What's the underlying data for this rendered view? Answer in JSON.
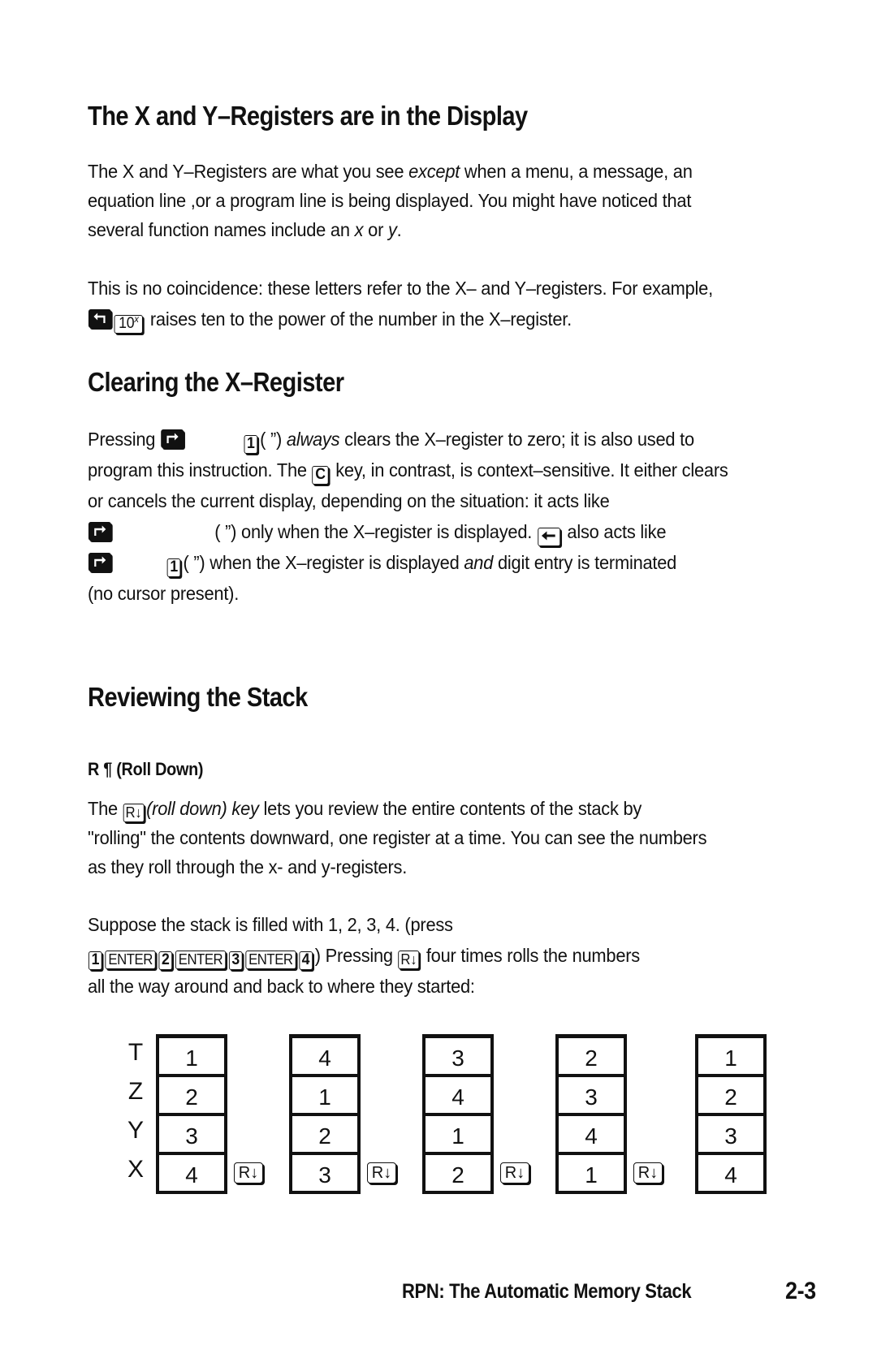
{
  "sections": {
    "display": {
      "heading": "The X and Y–Registers are in the Display",
      "para1": {
        "l1_a": "The X and Y–Registers are what you see ",
        "l1_em": "except",
        "l1_b": " when a menu, a message, an",
        "l2": "equation line ,or a program line is being displayed. You might have noticed that",
        "l3_a": "several function names include an ",
        "l3_x": "x",
        "l3_b": " or ",
        "l3_y": "y",
        "l3_c": "."
      },
      "para2": {
        "l1": "This is no coincidence: these letters refer to the X– and Y–registers. For example,",
        "l2_text": " raises ten to the power of the number in the X–register.",
        "key_ten": "10",
        "key_ten_sup": "x"
      }
    },
    "clearing": {
      "heading": "Clearing the X–Register",
      "l1_a": "Pressing ",
      "key_one": "1",
      "l1_b": "( ”) ",
      "l1_em": "always",
      "l1_c": " clears the X–register to zero; it is also used to",
      "l2_a": "program this instruction. The ",
      "key_c": "C",
      "l2_b": " key, in contrast, is context–sensitive. It either clears",
      "l3": "or cancels the current display, depending on the situation: it acts like",
      "l4_a": "( ”) only when the X–register is displayed. ",
      "l4_b": " also acts like",
      "l5_a": "( ”) when the X–register is displayed ",
      "l5_em": "and",
      "l5_b": " digit entry is terminated",
      "l6": "(no cursor present)."
    },
    "reviewing": {
      "heading": "Reviewing the Stack",
      "subheading": "R ¶ (Roll Down)",
      "para1": {
        "l1_a": "The ",
        "l1_em": "(roll down) key",
        "l1_b": " lets you review the entire contents of the stack by",
        "l2": "\"rolling\" the contents downward, one register at a time. You can see the numbers",
        "l3": "as they roll through the x- and y-registers."
      },
      "para2": {
        "l1": "Suppose the stack is filled with 1, 2, 3, 4. (press",
        "keys": [
          "1",
          "ENTER",
          "2",
          "ENTER",
          "3",
          "ENTER",
          "4"
        ],
        "l2_a": ") Pressing ",
        "l2_b": " four times rolls the numbers",
        "l3": "all the way around and back to where they started:"
      },
      "roll_key_label": "R↓"
    }
  },
  "stack_diagram": {
    "register_labels": [
      "T",
      "Z",
      "Y",
      "X"
    ],
    "states": [
      [
        "1",
        "2",
        "3",
        "4"
      ],
      [
        "4",
        "1",
        "2",
        "3"
      ],
      [
        "3",
        "4",
        "1",
        "2"
      ],
      [
        "2",
        "3",
        "4",
        "1"
      ],
      [
        "1",
        "2",
        "3",
        "4"
      ]
    ],
    "roll_key_label": "R↓"
  },
  "footer": {
    "chapter_title": "RPN: The Automatic Memory Stack",
    "page_number": "2-3"
  }
}
